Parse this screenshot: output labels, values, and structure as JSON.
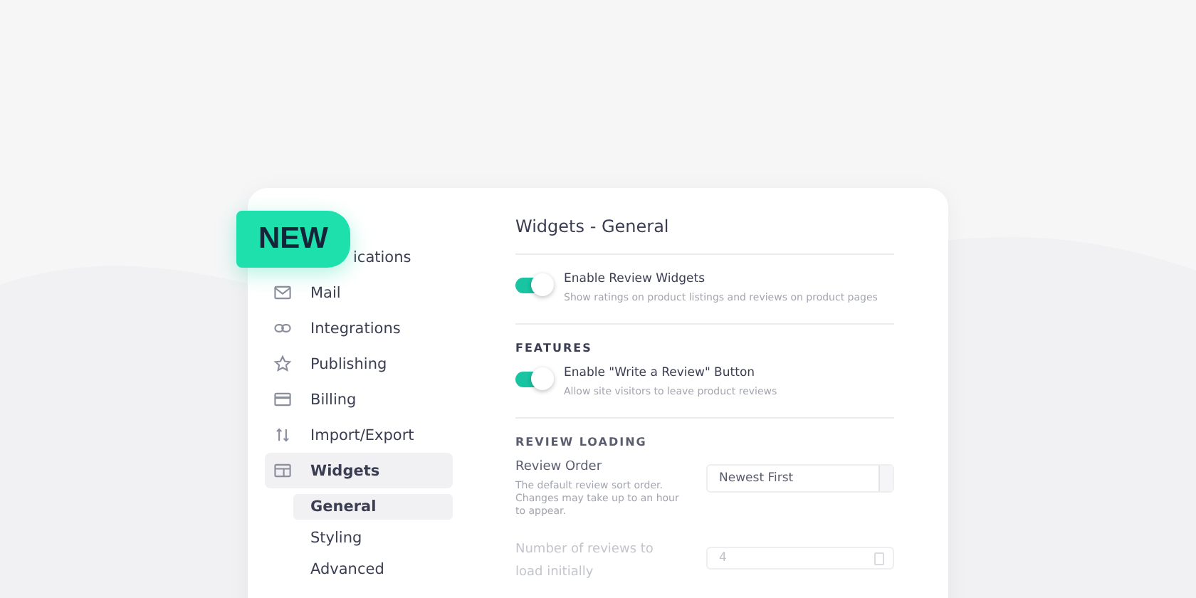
{
  "badge": {
    "label": "NEW"
  },
  "sidebar": {
    "items": [
      {
        "label": "ications",
        "selected": false
      },
      {
        "label": "Mail",
        "selected": false
      },
      {
        "label": "Integrations",
        "selected": false
      },
      {
        "label": "Publishing",
        "selected": false
      },
      {
        "label": "Billing",
        "selected": false
      },
      {
        "label": "Import/Export",
        "selected": false
      },
      {
        "label": "Widgets",
        "selected": true,
        "children": [
          {
            "label": "General",
            "selected": true
          },
          {
            "label": "Styling",
            "selected": false
          },
          {
            "label": "Advanced",
            "selected": false
          }
        ]
      }
    ]
  },
  "content": {
    "title": "Widgets - General",
    "sections": [
      {
        "rows": [
          {
            "kind": "toggle",
            "label": "Enable Review Widgets",
            "description": "Show ratings on product listings and reviews on product pages",
            "on": true
          }
        ]
      },
      {
        "heading": "FEATURES",
        "rows": [
          {
            "kind": "toggle",
            "label": "Enable \"Write a Review\" Button",
            "description": "Allow site visitors to leave product reviews",
            "on": true
          }
        ]
      },
      {
        "heading": "REVIEW LOADING",
        "rows": [
          {
            "kind": "select",
            "label": "Review Order",
            "description": "The default review sort order. Changes may take up to an hour to appear.",
            "value": "Newest First",
            "disabled": false
          },
          {
            "kind": "number",
            "label": "Number of reviews to load initially",
            "value": "4",
            "disabled": true
          }
        ]
      }
    ]
  }
}
